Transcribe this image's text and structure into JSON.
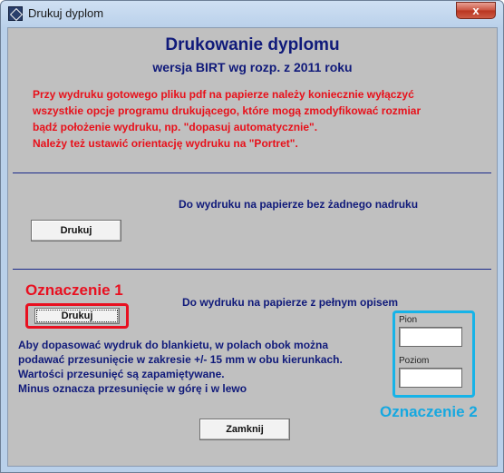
{
  "window": {
    "title": "Drukuj dyplom",
    "close_glyph": "x"
  },
  "header": {
    "title": "Drukowanie dyplomu",
    "subtitle": "wersja BIRT wg rozp. z 2011 roku"
  },
  "warning": {
    "line1": "Przy wydruku gotowego pliku pdf na papierze należy koniecznie wyłączyć",
    "line2": "wszystkie opcje programu drukującego, które mogą zmodyfikować rozmiar",
    "line3": "bądź położenie wydruku, np. \"dopasuj automatycznie\".",
    "line4": "Należy też ustawić orientację wydruku na \"Portret\"."
  },
  "section_blank": {
    "label": "Do wydruku na papierze bez żadnego nadruku",
    "button": "Drukuj"
  },
  "section_full": {
    "label": "Do wydruku na papierze z pełnym opisem",
    "button": "Drukuj"
  },
  "info": {
    "line1": "Aby dopasować wydruk do blankietu, w polach obok można",
    "line2": "podawać przesunięcie w zakresie +/- 15 mm w obu kierunkach.",
    "line3": "Wartości przesunięć są zapamiętywane.",
    "line4": "Minus oznacza przesunięcie w górę i w lewo"
  },
  "offsets": {
    "vertical_label": "Pion",
    "vertical_value": "",
    "horizontal_label": "Poziom",
    "horizontal_value": ""
  },
  "close_button": "Zamknij",
  "annotations": {
    "label1": "Oznaczenie 1",
    "label2": "Oznaczenie 2",
    "color1": "#e81020",
    "color2": "#16b3e8"
  }
}
